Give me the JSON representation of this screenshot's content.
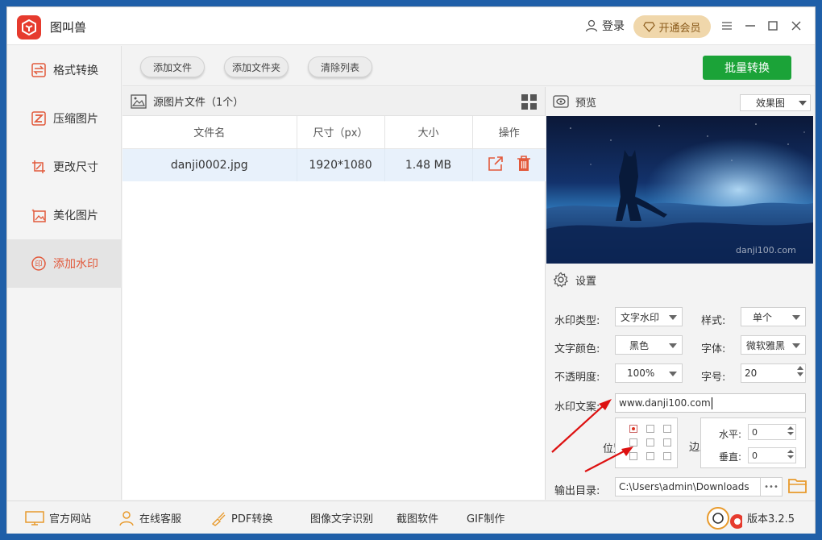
{
  "app": {
    "title": "图叫兽",
    "login": "登录",
    "vip": "开通会员"
  },
  "sidebar": {
    "items": [
      {
        "label": "格式转换",
        "icon": "convert-icon"
      },
      {
        "label": "压缩图片",
        "icon": "compress-icon"
      },
      {
        "label": "更改尺寸",
        "icon": "resize-icon"
      },
      {
        "label": "美化图片",
        "icon": "beautify-icon"
      },
      {
        "label": "添加水印",
        "icon": "watermark-icon",
        "active": true
      }
    ]
  },
  "toolbar": {
    "add_file": "添加文件",
    "add_folder": "添加文件夹",
    "clear_list": "清除列表",
    "batch_convert": "批量转换"
  },
  "files": {
    "header": "源图片文件（1个）",
    "columns": [
      "文件名",
      "尺寸（px）",
      "大小",
      "操作"
    ],
    "rows": [
      {
        "name": "danji0002.jpg",
        "dimensions": "1920*1080",
        "size": "1.48 MB"
      }
    ]
  },
  "preview": {
    "title": "预览",
    "mode": "效果图"
  },
  "settings": {
    "title": "设置",
    "type_label": "水印类型:",
    "type_value": "文字水印",
    "style_label": "样式:",
    "style_value": "单个",
    "color_label": "文字颜色:",
    "color_value": "黑色",
    "font_label": "字体:",
    "font_value": "微软雅黑",
    "opacity_label": "不透明度:",
    "opacity_value": "100%",
    "size_label": "字号:",
    "size_value": "20",
    "text_label": "水印文案:",
    "text_value": "www.danji100.com",
    "position_label": "位置",
    "margin_label": "边距",
    "horizontal_label": "水平:",
    "horizontal_value": "0",
    "vertical_label": "垂直:",
    "vertical_value": "0",
    "output_label": "输出目录:",
    "output_value": "C:\\Users\\admin\\Downloads",
    "browse": "•••"
  },
  "footer": {
    "items": [
      "官方网站",
      "在线客服",
      "PDF转换",
      "图像文字识别",
      "截图软件",
      "GIF制作"
    ],
    "version": "版本3.2.5"
  },
  "watermark_overlay": "danji100.com",
  "colors": {
    "accent": "#e2593b",
    "green": "#1ba338",
    "vip_bg": "#f0d7ab",
    "selected_row": "#e8f1fb"
  }
}
